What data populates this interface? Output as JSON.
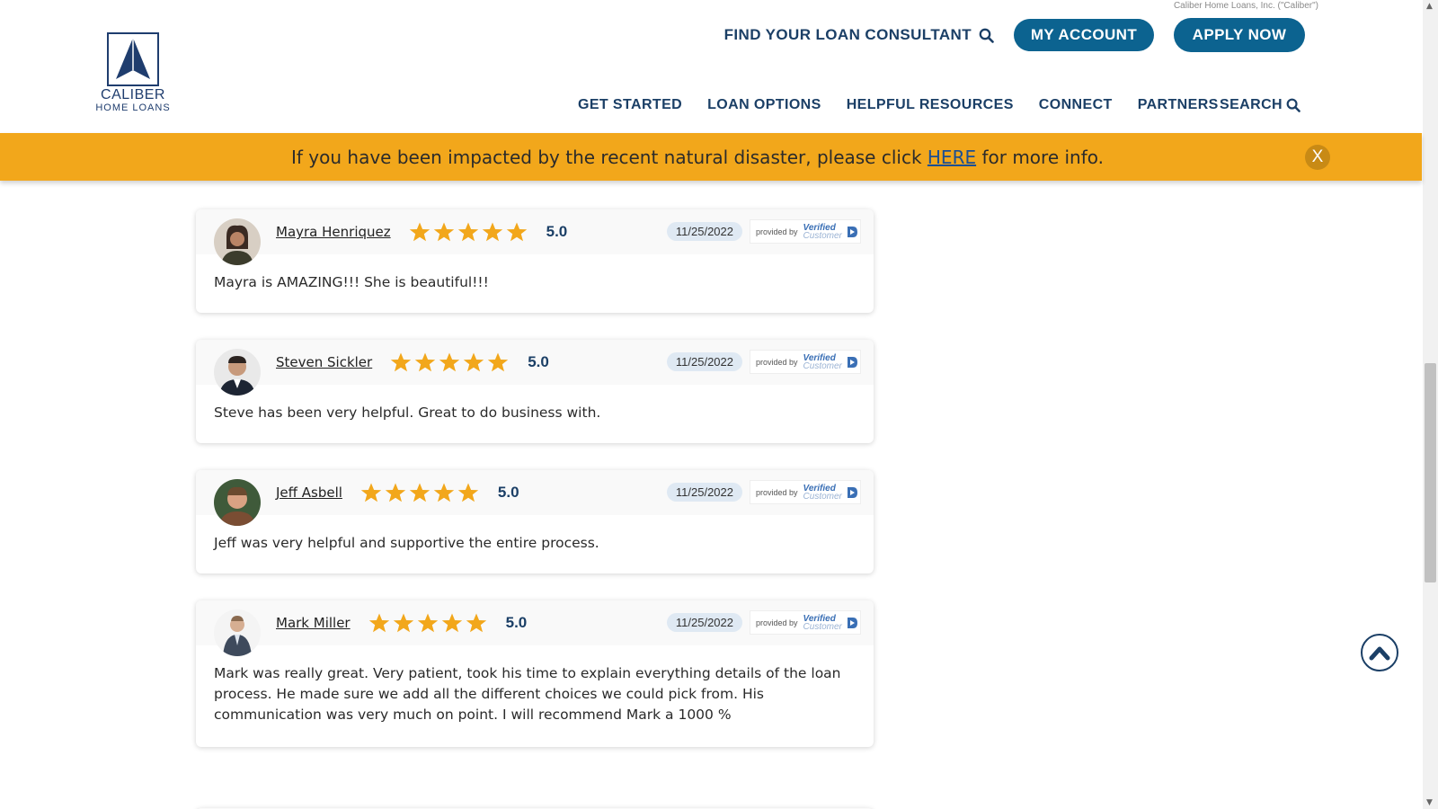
{
  "header": {
    "legal_text": "Caliber Home Loans, Inc. (\"Caliber\")",
    "logo": {
      "line1": "CALIBER",
      "line2": "HOME LOANS"
    },
    "find_consultant": "FIND YOUR LOAN CONSULTANT",
    "my_account": "MY ACCOUNT",
    "apply_now": "APPLY NOW",
    "nav": [
      "GET STARTED",
      "LOAN OPTIONS",
      "HELPFUL RESOURCES",
      "CONNECT",
      "PARTNERS"
    ],
    "search": "SEARCH"
  },
  "banner": {
    "text_before": "If you have been impacted by the recent natural disaster, please click ",
    "link": "HERE",
    "text_after": " for more info.",
    "close": "X",
    "color": "#f2a71b"
  },
  "badge": {
    "provided_by": "provided by",
    "verified": "Verified",
    "customer": "Customer"
  },
  "reviews": [
    {
      "name": "Mayra Henriquez",
      "rating": "5.0",
      "stars": 5,
      "date": "11/25/2022",
      "text": "Mayra is AMAZING!!! She is beautiful!!!"
    },
    {
      "name": "Steven Sickler",
      "rating": "5.0",
      "stars": 5,
      "date": "11/25/2022",
      "text": "Steve has been very helpful. Great to do business with."
    },
    {
      "name": "Jeff Asbell",
      "rating": "5.0",
      "stars": 5,
      "date": "11/25/2022",
      "text": "Jeff was very helpful and supportive the entire process."
    },
    {
      "name": "Mark Miller",
      "rating": "5.0",
      "stars": 5,
      "date": "11/25/2022",
      "text": "Mark was really great. Very patient, took his time to explain everything details of the loan process. He made sure we add all the different choices we could pick from. His communication was very much on point. I will recommend Mark a 1000 %"
    }
  ],
  "colors": {
    "brand_navy": "#1b3f66",
    "button_blue": "#0c6390",
    "star": "#f2a71b"
  }
}
